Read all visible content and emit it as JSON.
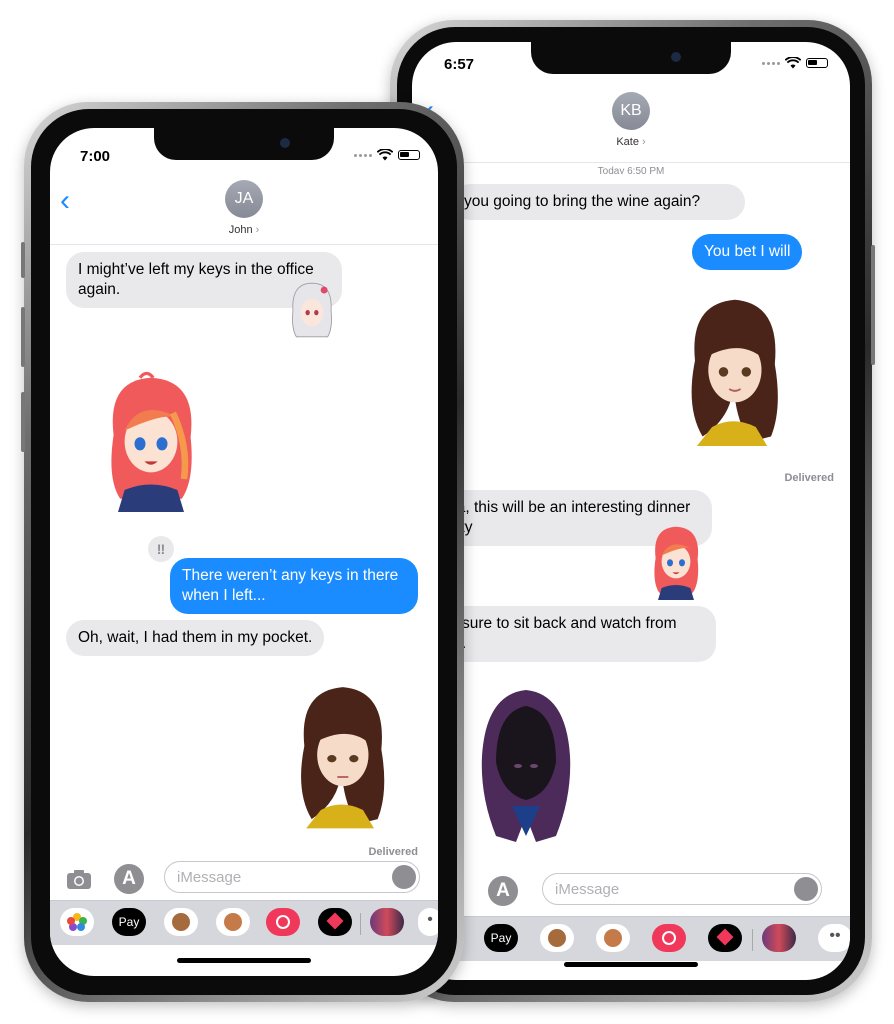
{
  "colors": {
    "imessage_blue": "#1a8cff",
    "bubble_gray": "#e9e9eb",
    "drawer_gray": "#d6d7dc"
  },
  "phone_back": {
    "status": {
      "time": "6:57"
    },
    "contact": {
      "initials": "KB",
      "name": "Kate"
    },
    "timestamp": "Today 6:50 PM",
    "messages": [
      {
        "dir": "in",
        "text": "you going to bring the wine again?"
      },
      {
        "dir": "out",
        "text": "You bet I will"
      },
      {
        "dir": "sticker",
        "name": "brunette-girl-sticker"
      },
      {
        "dir": "status",
        "text": "Delivered"
      },
      {
        "dir": "in",
        "text": "Ha ha, this will be an interesting dinner party"
      },
      {
        "dir": "sticker",
        "name": "redhead-girl-sticker"
      },
      {
        "dir": "in",
        "text": "I'll be sure to sit back and watch from afar."
      },
      {
        "dir": "sticker",
        "name": "hooded-figure-sticker"
      }
    ],
    "input_placeholder": "iMessage",
    "apps": [
      "apple-pay-icon",
      "monkey-memoji-icon",
      "memoji-icon",
      "search-images-icon",
      "heart-digital-touch-icon",
      "sticker-pack-icon",
      "more-apps-icon"
    ],
    "apple_pay_label": "Pay"
  },
  "phone_front": {
    "status": {
      "time": "7:00"
    },
    "contact": {
      "initials": "JA",
      "name": "John"
    },
    "messages": [
      {
        "dir": "in",
        "text": "I might’ve left my keys in the office again."
      },
      {
        "dir": "sticker",
        "name": "white-hair-girl-sticker"
      },
      {
        "dir": "sticker",
        "name": "redhead-girl-sticker"
      },
      {
        "dir": "out",
        "text": "There weren’t any keys in there when I left..."
      },
      {
        "dir": "in",
        "text": "Oh, wait, I had them in my pocket."
      },
      {
        "dir": "sticker",
        "name": "brunette-girl-sticker"
      },
      {
        "dir": "status",
        "text": "Delivered"
      }
    ],
    "input_placeholder": "iMessage",
    "apps": [
      "photos-icon",
      "apple-pay-icon",
      "monkey-memoji-icon",
      "memoji-icon",
      "search-images-icon",
      "heart-digital-touch-icon",
      "sticker-pack-icon",
      "more-apps-icon"
    ],
    "apple_pay_label": "Pay"
  }
}
